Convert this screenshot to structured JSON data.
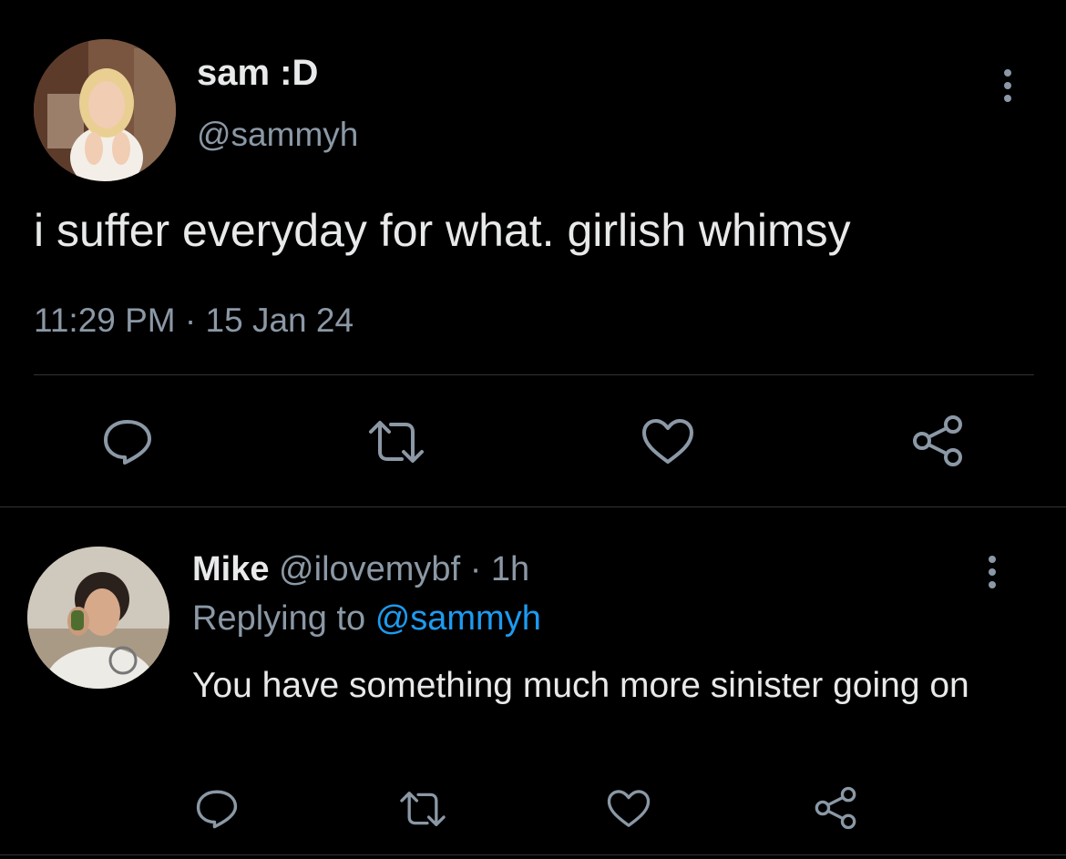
{
  "main_tweet": {
    "display_name": "sam :D",
    "handle": "@sammyh",
    "text": "i suffer everyday for what. girlish whimsy",
    "time": "11:29 PM",
    "separator": "·",
    "date": "15 Jan 24",
    "icons": [
      "reply-icon",
      "retweet-icon",
      "like-icon",
      "share-icon",
      "more-icon"
    ]
  },
  "reply": {
    "display_name": "Mike",
    "handle": "@ilovemybf",
    "separator": "·",
    "age": "1h",
    "replying_prefix": "Replying to",
    "replying_to": "@sammyh",
    "text": "You have something much more sinister going on",
    "icons": [
      "reply-icon",
      "retweet-icon",
      "like-icon",
      "share-icon",
      "more-icon"
    ]
  },
  "colors": {
    "background": "#000000",
    "primary_text": "#e7e9ea",
    "secondary_text": "#8b98a5",
    "link": "#1d9bf0",
    "divider": "#2f3336"
  }
}
